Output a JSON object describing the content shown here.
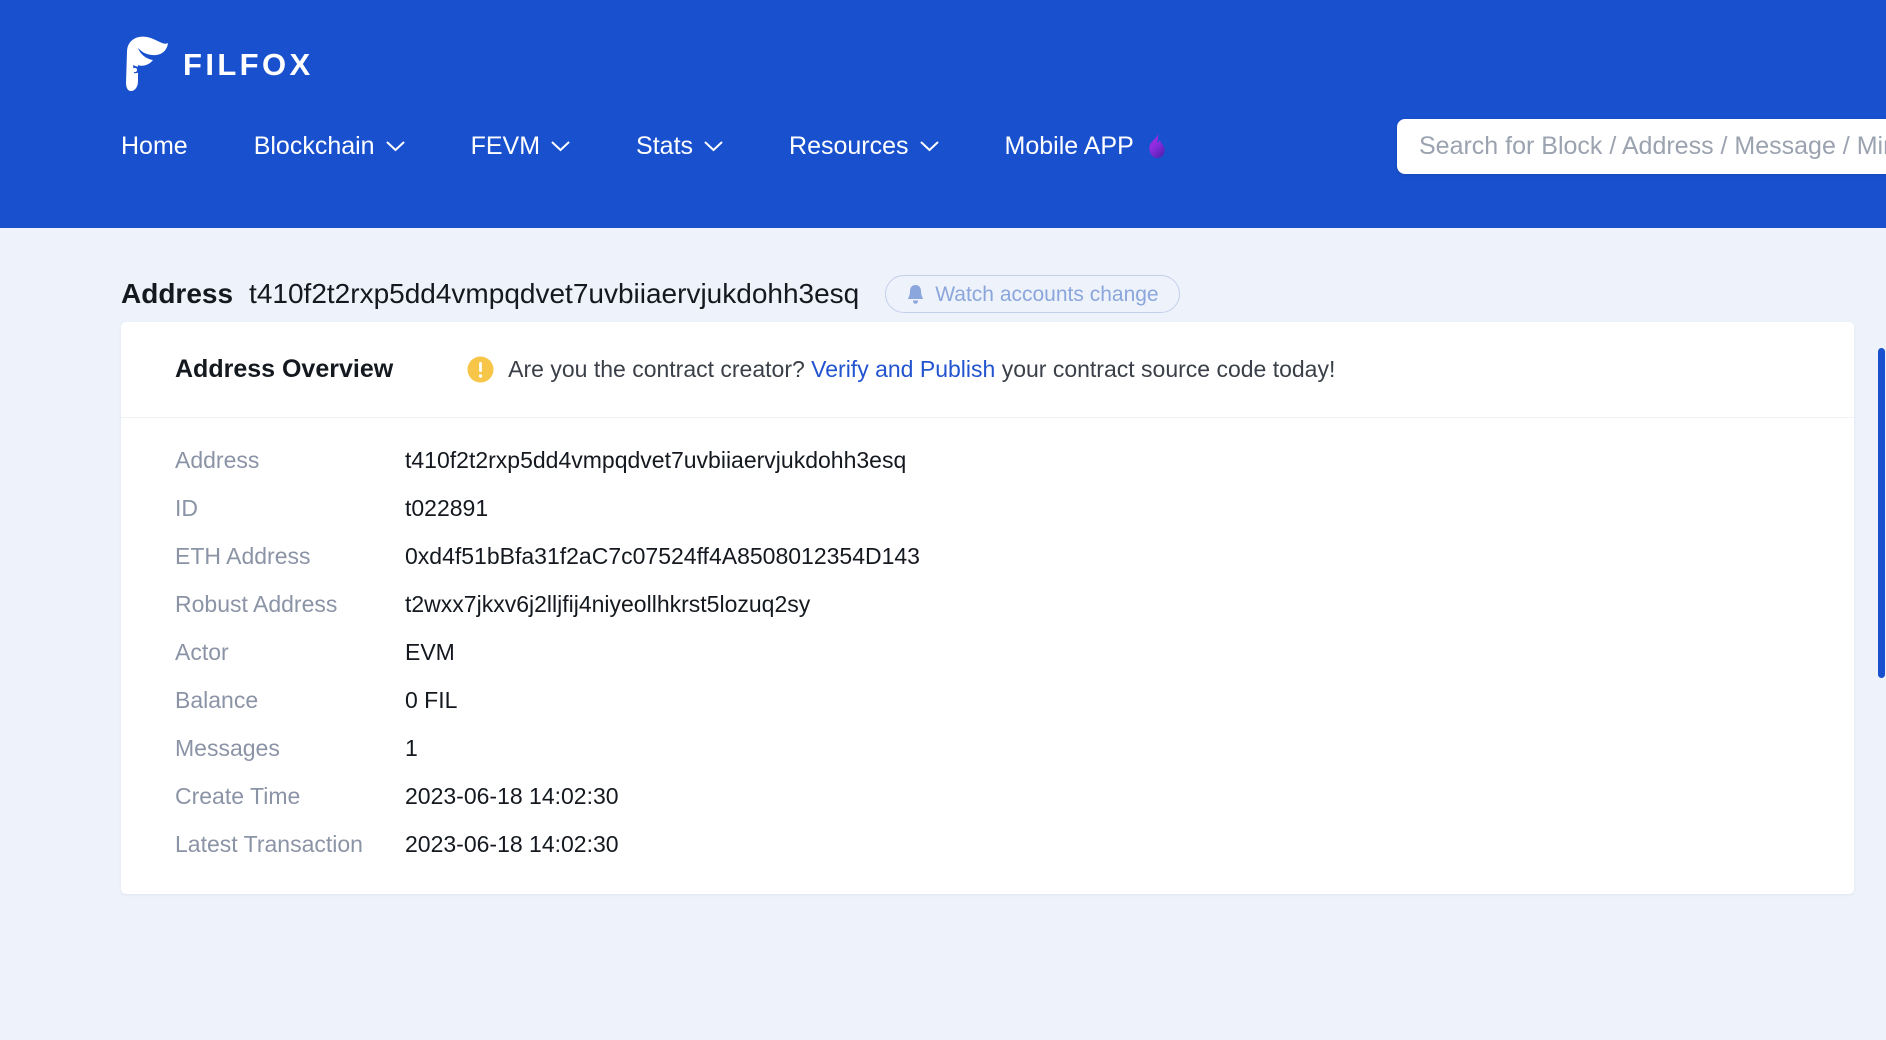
{
  "brand": {
    "name": "FILFOX",
    "logo_icon": "fox-head-icon",
    "header_color": "#1950ce"
  },
  "nav": {
    "items": [
      {
        "label": "Home",
        "has_dropdown": false
      },
      {
        "label": "Blockchain",
        "has_dropdown": true
      },
      {
        "label": "FEVM",
        "has_dropdown": true
      },
      {
        "label": "Stats",
        "has_dropdown": true
      },
      {
        "label": "Resources",
        "has_dropdown": true
      },
      {
        "label": "Mobile APP",
        "has_dropdown": false,
        "badge_icon": "flame-icon"
      }
    ]
  },
  "search": {
    "placeholder": "Search for Block / Address / Message / Miner / Tipset",
    "value": ""
  },
  "page": {
    "title_label": "Address",
    "title_address": "t410f2t2rxp5dd4vmpqdvet7uvbiiaervjukdohh3esq",
    "watch_button": {
      "label": "Watch accounts change",
      "icon": "bell-icon",
      "border_color": "#c3d0ec",
      "text_color": "#8ba6dd"
    }
  },
  "card": {
    "title": "Address Overview",
    "notice": {
      "icon": "warning-circle-icon",
      "icon_color": "#f7c648",
      "text_before": "Are you the contract creator?",
      "link_label": "Verify and Publish",
      "link_color": "#2254cf",
      "text_after": "your contract source code today!"
    },
    "rows": [
      {
        "label": "Address",
        "value": "t410f2t2rxp5dd4vmpqdvet7uvbiiaervjukdohh3esq"
      },
      {
        "label": "ID",
        "value": "t022891"
      },
      {
        "label": "ETH Address",
        "value": "0xd4f51bBfa31f2aC7c07524ff4A8508012354D143"
      },
      {
        "label": "Robust Address",
        "value": "t2wxx7jkxv6j2lljfij4niyeollhkrst5lozuq2sy"
      },
      {
        "label": "Actor",
        "value": "EVM"
      },
      {
        "label": "Balance",
        "value": "0 FIL"
      },
      {
        "label": "Messages",
        "value": "1"
      },
      {
        "label": "Create Time",
        "value": "2023-06-18 14:02:30"
      },
      {
        "label": "Latest Transaction",
        "value": "2023-06-18 14:02:30"
      }
    ]
  }
}
